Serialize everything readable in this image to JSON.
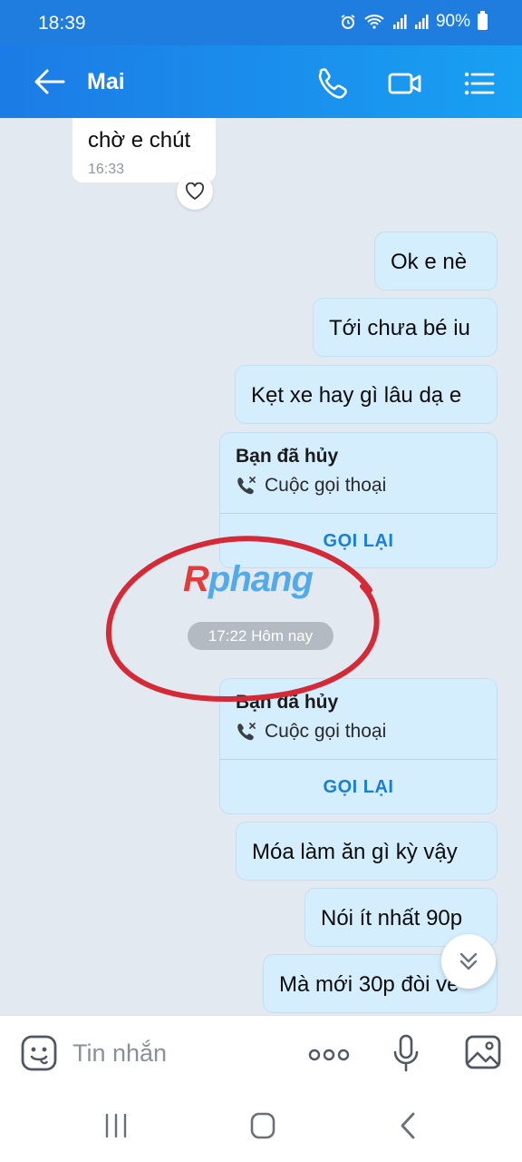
{
  "status_bar": {
    "time": "18:39",
    "battery": "90%"
  },
  "header": {
    "contact_name": "Mai"
  },
  "messages": [
    {
      "text": "chờ e chút",
      "time": "16:33"
    },
    {
      "text": "Ok e nè"
    },
    {
      "text": "Tới chưa bé iu"
    },
    {
      "text": "Kẹt xe hay gì lâu dạ e"
    },
    {
      "text": "Móa làm ăn gì kỳ vậy"
    },
    {
      "text": "Nói ít nhất 90p"
    },
    {
      "text": "Mà mới 30p đòi về"
    }
  ],
  "calls": [
    {
      "title": "Bạn đã hủy",
      "subtitle": "Cuộc gọi thoại",
      "action": "GỌI LẠI"
    },
    {
      "title": "Bạn đã hủy",
      "subtitle": "Cuộc gọi thoại",
      "action": "GỌI LẠI"
    }
  ],
  "date_separator": "17:22 Hôm nay",
  "watermark": {
    "first": "R",
    "rest": "phang"
  },
  "input": {
    "placeholder": "Tin nhắn"
  },
  "colors": {
    "header": "#1c7be6",
    "my_bubble": "#d5eefe",
    "annotation_circle": "#d42a38",
    "call_action": "#1a7fd4"
  }
}
